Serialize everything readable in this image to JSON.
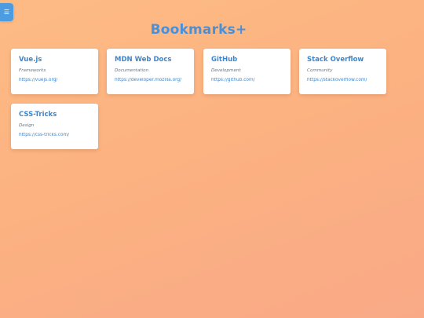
{
  "header": {
    "menu_icon": "☰",
    "title": "Bookmarks+"
  },
  "bookmarks": [
    {
      "name": "Vue.js",
      "category": "Frameworks",
      "url": "https://vuejs.org/"
    },
    {
      "name": "MDN Web Docs",
      "category": "Documentation",
      "url": "https://developer.mozilla.org/"
    },
    {
      "name": "GitHub",
      "category": "Development",
      "url": "https://github.com/"
    },
    {
      "name": "Stack Overflow",
      "category": "Community",
      "url": "https://stackoverflow.com/"
    },
    {
      "name": "CSS-Tricks",
      "category": "Design",
      "url": "https://css-tricks.com/"
    }
  ],
  "colors": {
    "accent": "#4a90d9",
    "background": "#fdbb84",
    "card": "#ffffff"
  }
}
